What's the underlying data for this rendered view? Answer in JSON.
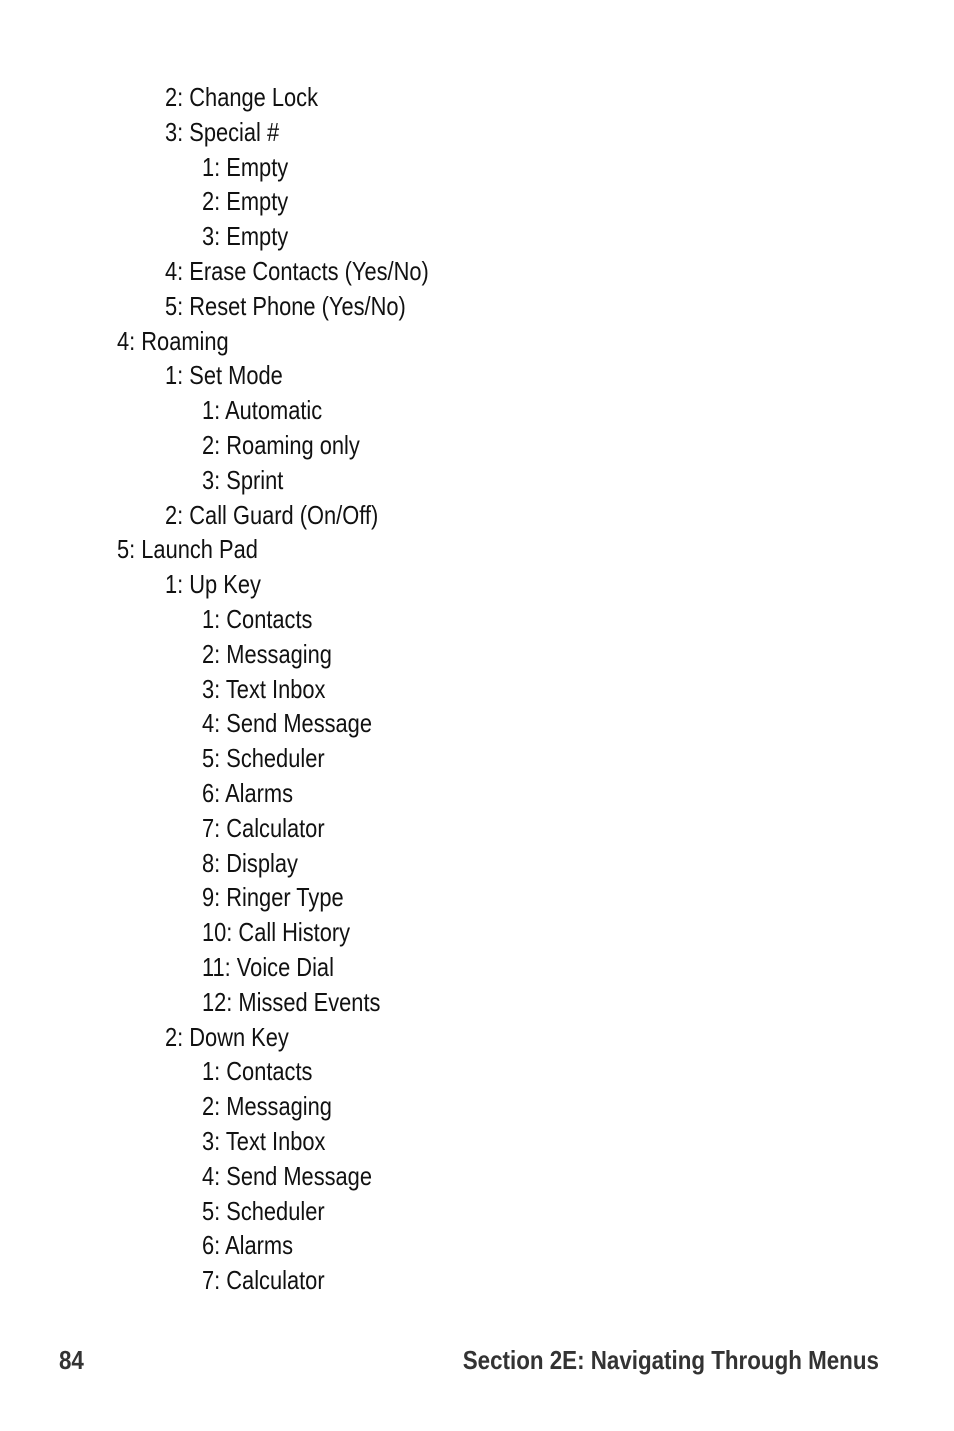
{
  "menu": [
    {
      "level": 2,
      "text": "2: Change Lock"
    },
    {
      "level": 2,
      "text": "3: Special #"
    },
    {
      "level": 3,
      "text": "1: Empty"
    },
    {
      "level": 3,
      "text": "2: Empty"
    },
    {
      "level": 3,
      "text": "3: Empty"
    },
    {
      "level": 2,
      "text": "4: Erase Contacts (Yes/No)"
    },
    {
      "level": 2,
      "text": "5: Reset Phone (Yes/No)"
    },
    {
      "level": 1,
      "text": "4: Roaming"
    },
    {
      "level": 2,
      "text": "1: Set Mode"
    },
    {
      "level": 3,
      "text": "1: Automatic"
    },
    {
      "level": 3,
      "text": "2: Roaming only"
    },
    {
      "level": 3,
      "text": "3: Sprint"
    },
    {
      "level": 2,
      "text": "2: Call Guard (On/Off)"
    },
    {
      "level": 1,
      "text": "5: Launch Pad"
    },
    {
      "level": 2,
      "text": "1: Up Key"
    },
    {
      "level": 3,
      "text": "1: Contacts"
    },
    {
      "level": 3,
      "text": "2: Messaging"
    },
    {
      "level": 3,
      "text": "3: Text Inbox"
    },
    {
      "level": 3,
      "text": "4: Send Message"
    },
    {
      "level": 3,
      "text": "5: Scheduler"
    },
    {
      "level": 3,
      "text": "6: Alarms"
    },
    {
      "level": 3,
      "text": "7: Calculator"
    },
    {
      "level": 3,
      "text": "8: Display"
    },
    {
      "level": 3,
      "text": "9: Ringer Type"
    },
    {
      "level": 3,
      "text": "10: Call History"
    },
    {
      "level": 3,
      "text": "11: Voice Dial"
    },
    {
      "level": 3,
      "text": "12: Missed Events"
    },
    {
      "level": 2,
      "text": "2: Down Key"
    },
    {
      "level": 3,
      "text": "1: Contacts"
    },
    {
      "level": 3,
      "text": "2: Messaging"
    },
    {
      "level": 3,
      "text": "3: Text Inbox"
    },
    {
      "level": 3,
      "text": "4: Send Message"
    },
    {
      "level": 3,
      "text": "5: Scheduler"
    },
    {
      "level": 3,
      "text": "6: Alarms"
    },
    {
      "level": 3,
      "text": "7: Calculator"
    }
  ],
  "footer": {
    "page_number": "84",
    "section_title": "Section 2E: Navigating Through Menus"
  }
}
